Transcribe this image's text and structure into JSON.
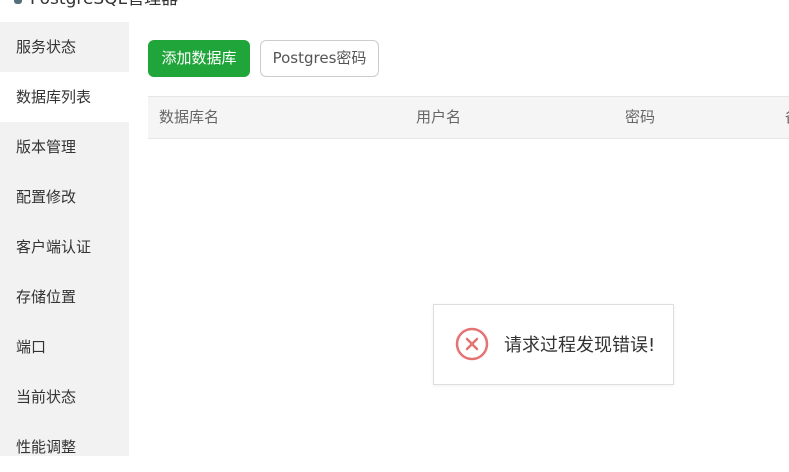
{
  "window": {
    "title": "PostgreSQL管理器",
    "icon": "postgres-elephant-icon"
  },
  "sidebar": {
    "items": [
      {
        "label": "服务状态",
        "active": false
      },
      {
        "label": "数据库列表",
        "active": true
      },
      {
        "label": "版本管理",
        "active": false
      },
      {
        "label": "配置修改",
        "active": false
      },
      {
        "label": "客户端认证",
        "active": false
      },
      {
        "label": "存储位置",
        "active": false
      },
      {
        "label": "端口",
        "active": false
      },
      {
        "label": "当前状态",
        "active": false
      },
      {
        "label": "性能调整",
        "active": false
      }
    ]
  },
  "toolbar": {
    "add_database_label": "添加数据库",
    "postgres_password_label": "Postgres密码"
  },
  "table": {
    "columns": [
      "数据库名",
      "用户名",
      "密码",
      "备"
    ],
    "rows": []
  },
  "toast": {
    "message": "请求过程发现错误!",
    "icon": "error-x-icon",
    "icon_color": "#e57373"
  },
  "colors": {
    "accent": "#20a53a",
    "sidebar_bg": "#f2f2f2",
    "error": "#e57373"
  }
}
